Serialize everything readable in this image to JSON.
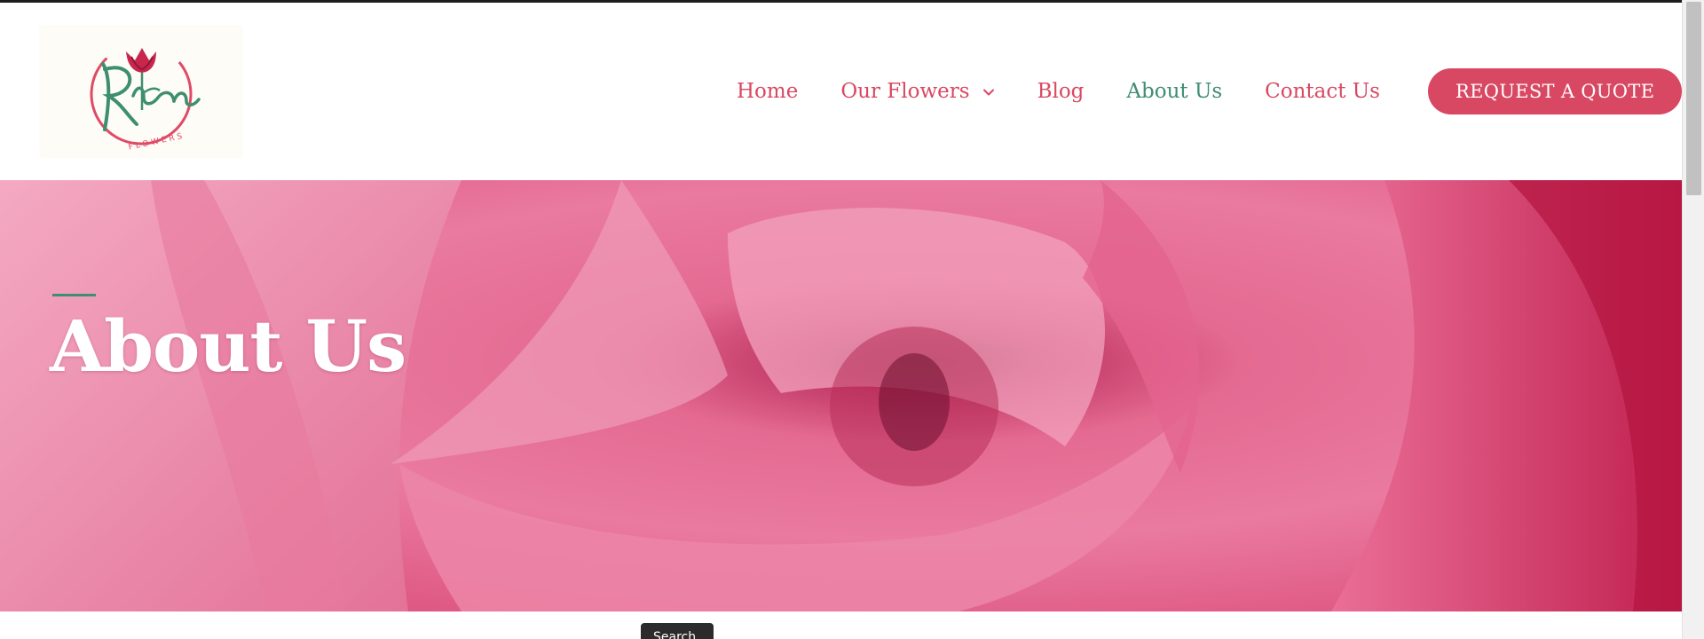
{
  "brand": {
    "name": "Rhema",
    "subtitle": "FLOWERS",
    "logo_icon": "rose-logo-icon"
  },
  "nav": {
    "items": [
      {
        "label": "Home"
      },
      {
        "label": "Our Flowers",
        "icon": "chevron-down-icon"
      },
      {
        "label": "Blog"
      },
      {
        "label": "About Us",
        "active": true
      },
      {
        "label": "Contact Us"
      }
    ],
    "cta_label": "REQUEST A QUOTE"
  },
  "hero": {
    "title": "About Us",
    "background": "pink-rose-photo"
  },
  "tooltip": {
    "text": "Search"
  },
  "colors": {
    "brand_pink": "#d94862",
    "brand_green": "#3e8e70",
    "hero_rose": "#e05b87"
  }
}
